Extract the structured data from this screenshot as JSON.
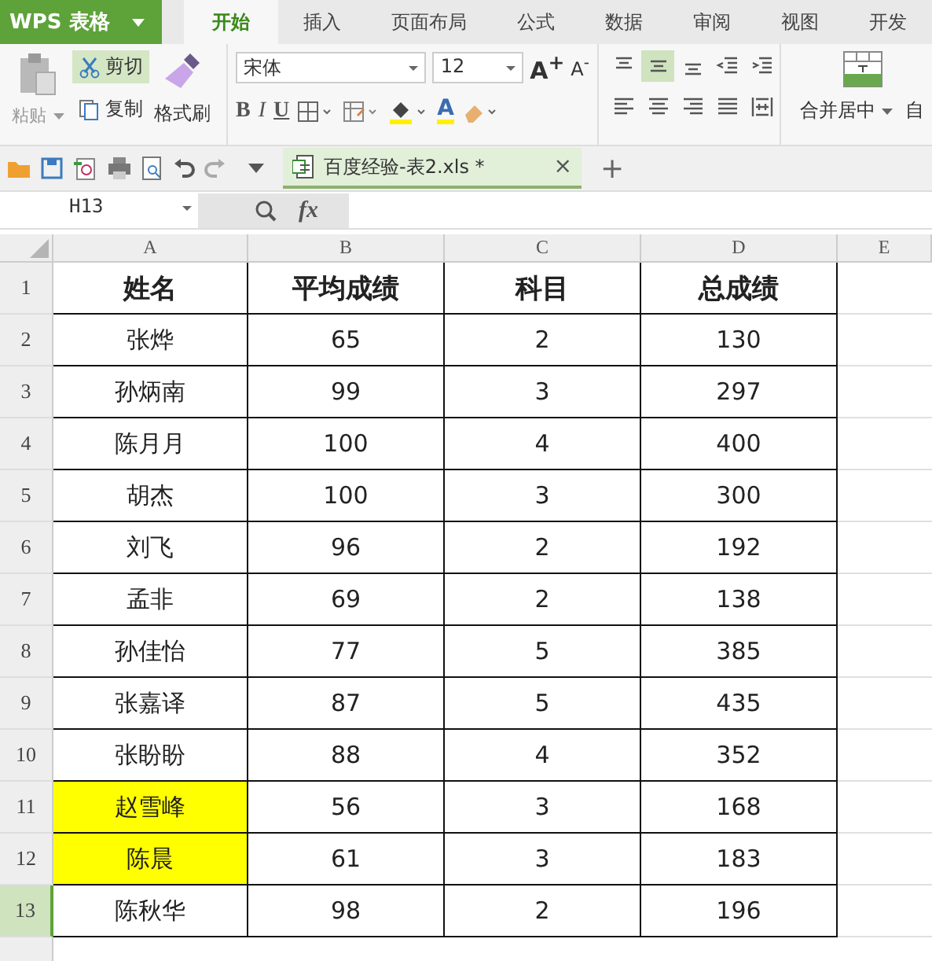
{
  "app": {
    "title": "WPS 表格"
  },
  "tabs": [
    {
      "label": "开始",
      "selected": true
    },
    {
      "label": "插入",
      "selected": false
    },
    {
      "label": "页面布局",
      "selected": false
    },
    {
      "label": "公式",
      "selected": false
    },
    {
      "label": "数据",
      "selected": false
    },
    {
      "label": "审阅",
      "selected": false
    },
    {
      "label": "视图",
      "selected": false
    },
    {
      "label": "开发",
      "selected": false
    }
  ],
  "clipboard": {
    "paste": "粘贴",
    "cut": "剪切",
    "cut_active": true,
    "copy": "复制",
    "format_painter": "格式刷"
  },
  "font": {
    "name": "宋体",
    "size": "12",
    "grow": "A$^{+}$",
    "shrink": "A$^{-}$",
    "bold": "B",
    "italic": "I",
    "underline": "U",
    "color_letter": "A"
  },
  "align_buttons": [
    {
      "kind": "top",
      "selected": false
    },
    {
      "kind": "middle",
      "selected": true
    },
    {
      "kind": "bottom",
      "selected": false
    },
    {
      "kind": "outdent",
      "selected": false
    },
    {
      "kind": "indent",
      "selected": false
    },
    {
      "kind": "left",
      "selected": false
    },
    {
      "kind": "center",
      "selected": false
    },
    {
      "kind": "right",
      "selected": false
    },
    {
      "kind": "justify",
      "selected": false
    },
    {
      "kind": "distribute",
      "selected": false
    }
  ],
  "merge": {
    "label": "合并居中",
    "next": "自"
  },
  "document_tab": {
    "title": "百度经验-表2.xls *",
    "close": "×",
    "add": "+"
  },
  "formula_bar": {
    "cell": "H13",
    "fx": "fx"
  },
  "sheet": {
    "columns": [
      "A",
      "B",
      "C",
      "D",
      "E"
    ],
    "rows": [
      {
        "number": "1",
        "selected": false,
        "kind": "header",
        "cells": [
          {
            "text": "姓名",
            "highlighted": false
          },
          {
            "text": "平均成绩",
            "highlighted": false
          },
          {
            "text": "科目",
            "highlighted": false
          },
          {
            "text": "总成绩",
            "highlighted": false
          }
        ]
      },
      {
        "number": "2",
        "selected": false,
        "kind": "data",
        "cells": [
          {
            "text": "张烨",
            "highlighted": false
          },
          {
            "text": "65",
            "highlighted": false
          },
          {
            "text": "2",
            "highlighted": false
          },
          {
            "text": "130",
            "highlighted": false
          }
        ]
      },
      {
        "number": "3",
        "selected": false,
        "kind": "data",
        "cells": [
          {
            "text": "孙炳南",
            "highlighted": false
          },
          {
            "text": "99",
            "highlighted": false
          },
          {
            "text": "3",
            "highlighted": false
          },
          {
            "text": "297",
            "highlighted": false
          }
        ]
      },
      {
        "number": "4",
        "selected": false,
        "kind": "data",
        "cells": [
          {
            "text": "陈月月",
            "highlighted": false
          },
          {
            "text": "100",
            "highlighted": false
          },
          {
            "text": "4",
            "highlighted": false
          },
          {
            "text": "400",
            "highlighted": false
          }
        ]
      },
      {
        "number": "5",
        "selected": false,
        "kind": "data",
        "cells": [
          {
            "text": "胡杰",
            "highlighted": false
          },
          {
            "text": "100",
            "highlighted": false
          },
          {
            "text": "3",
            "highlighted": false
          },
          {
            "text": "300",
            "highlighted": false
          }
        ]
      },
      {
        "number": "6",
        "selected": false,
        "kind": "data",
        "cells": [
          {
            "text": "刘飞",
            "highlighted": false
          },
          {
            "text": "96",
            "highlighted": false
          },
          {
            "text": "2",
            "highlighted": false
          },
          {
            "text": "192",
            "highlighted": false
          }
        ]
      },
      {
        "number": "7",
        "selected": false,
        "kind": "data",
        "cells": [
          {
            "text": "孟非",
            "highlighted": false
          },
          {
            "text": "69",
            "highlighted": false
          },
          {
            "text": "2",
            "highlighted": false
          },
          {
            "text": "138",
            "highlighted": false
          }
        ]
      },
      {
        "number": "8",
        "selected": false,
        "kind": "data",
        "cells": [
          {
            "text": "孙佳怡",
            "highlighted": false
          },
          {
            "text": "77",
            "highlighted": false
          },
          {
            "text": "5",
            "highlighted": false
          },
          {
            "text": "385",
            "highlighted": false
          }
        ]
      },
      {
        "number": "9",
        "selected": false,
        "kind": "data",
        "cells": [
          {
            "text": "张嘉译",
            "highlighted": false
          },
          {
            "text": "87",
            "highlighted": false
          },
          {
            "text": "5",
            "highlighted": false
          },
          {
            "text": "435",
            "highlighted": false
          }
        ]
      },
      {
        "number": "10",
        "selected": false,
        "kind": "data",
        "cells": [
          {
            "text": "张盼盼",
            "highlighted": false
          },
          {
            "text": "88",
            "highlighted": false
          },
          {
            "text": "4",
            "highlighted": false
          },
          {
            "text": "352",
            "highlighted": false
          }
        ]
      },
      {
        "number": "11",
        "selected": false,
        "kind": "data",
        "cells": [
          {
            "text": "赵雪峰",
            "highlighted": true
          },
          {
            "text": "56",
            "highlighted": false
          },
          {
            "text": "3",
            "highlighted": false
          },
          {
            "text": "168",
            "highlighted": false
          }
        ]
      },
      {
        "number": "12",
        "selected": false,
        "kind": "data",
        "cells": [
          {
            "text": "陈晨",
            "highlighted": true
          },
          {
            "text": "61",
            "highlighted": false
          },
          {
            "text": "3",
            "highlighted": false
          },
          {
            "text": "183",
            "highlighted": false
          }
        ]
      },
      {
        "number": "13",
        "selected": true,
        "kind": "data",
        "cells": [
          {
            "text": "陈秋华",
            "highlighted": false
          },
          {
            "text": "98",
            "highlighted": false
          },
          {
            "text": "2",
            "highlighted": false
          },
          {
            "text": "196",
            "highlighted": false
          }
        ]
      }
    ]
  }
}
